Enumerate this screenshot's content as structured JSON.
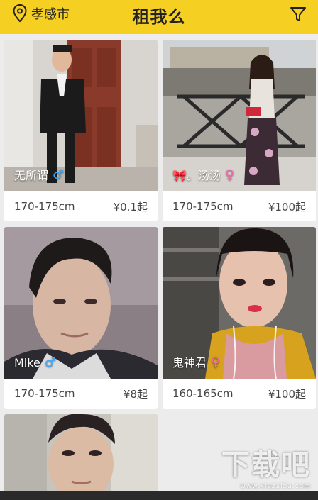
{
  "header": {
    "location": "孝感市",
    "title": "租我么",
    "accent_color": "#f5cf22"
  },
  "cards": [
    {
      "name": "无所谓",
      "gender": "male",
      "gender_symbol": "♂",
      "height": "170-175cm",
      "price": "¥0.1起"
    },
    {
      "name": "🎀。汤汤",
      "gender": "female",
      "gender_symbol": "♀",
      "height": "170-175cm",
      "price": "¥100起"
    },
    {
      "name": "Mike",
      "gender": "male",
      "gender_symbol": "♂",
      "height": "170-175cm",
      "price": "¥8起"
    },
    {
      "name": "鬼神君",
      "gender": "female",
      "gender_symbol": "♀",
      "height": "160-165cm",
      "price": "¥100起"
    }
  ],
  "watermark": {
    "text": "下载吧",
    "sub": "www.xiazaiba.com"
  },
  "icons": [
    "location-pin-icon",
    "filter-icon",
    "male-icon",
    "female-icon"
  ]
}
